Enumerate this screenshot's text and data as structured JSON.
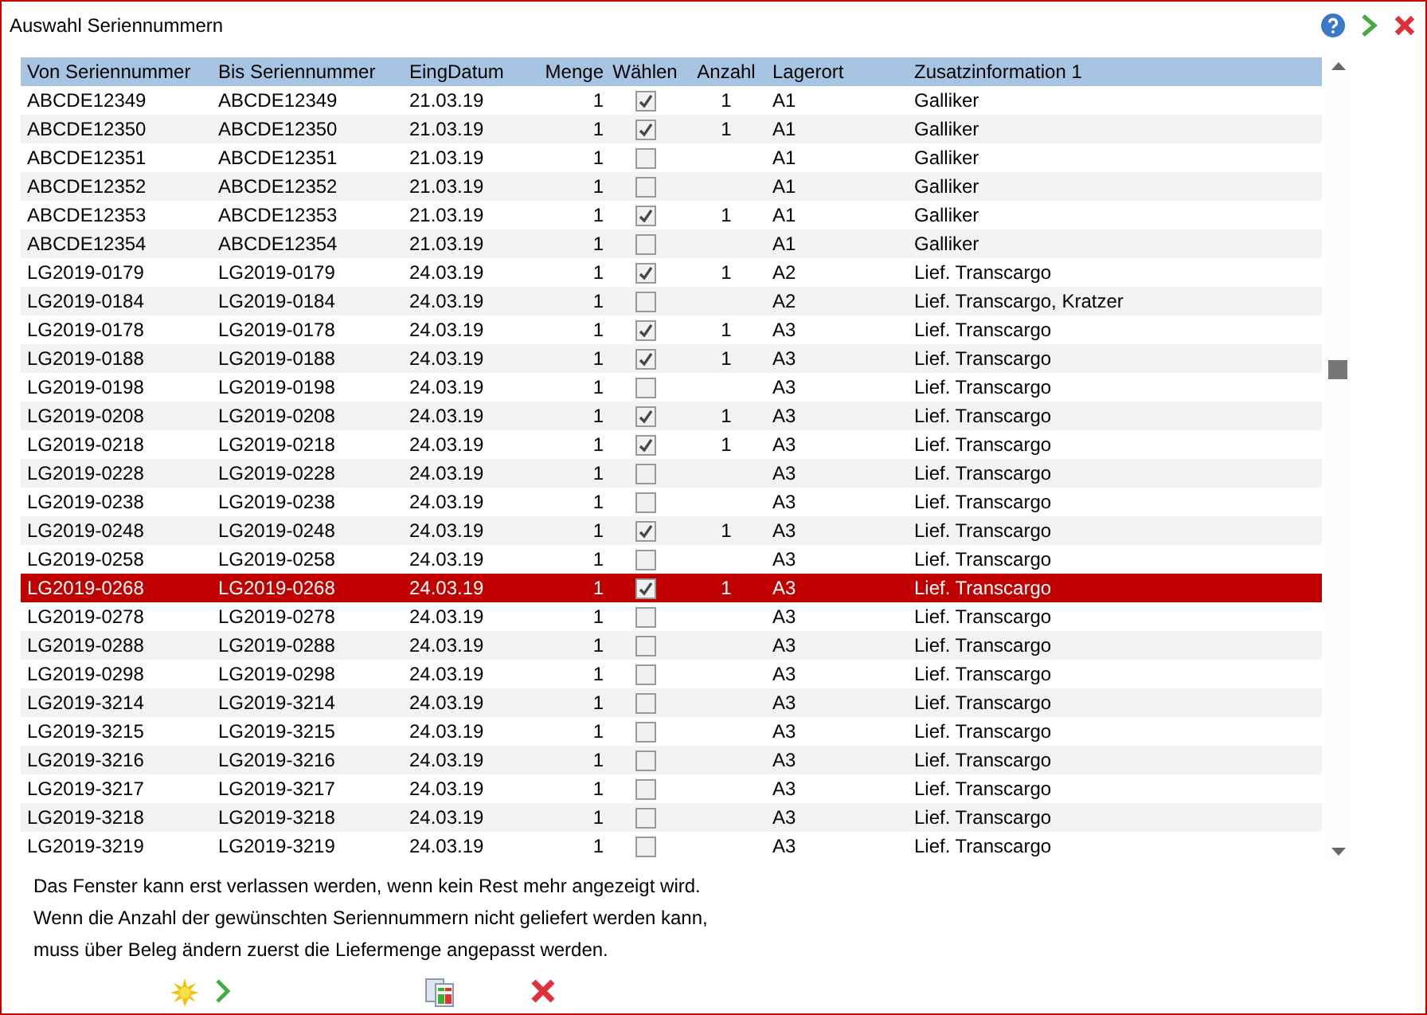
{
  "window": {
    "title": "Auswahl Seriennummern"
  },
  "table": {
    "columns": [
      "Von Seriennummer",
      "Bis Seriennummer",
      "EingDatum",
      "Menge",
      "Wählen",
      "Anzahl",
      "Lagerort",
      "Zusatzinformation 1"
    ],
    "rows": [
      {
        "von": "ABCDE12349",
        "bis": "ABCDE12349",
        "datum": "21.03.19",
        "menge": "1",
        "checked": true,
        "anzahl": "1",
        "lagerort": "A1",
        "zusatz": "Galliker",
        "selected": false
      },
      {
        "von": "ABCDE12350",
        "bis": "ABCDE12350",
        "datum": "21.03.19",
        "menge": "1",
        "checked": true,
        "anzahl": "1",
        "lagerort": "A1",
        "zusatz": "Galliker",
        "selected": false
      },
      {
        "von": "ABCDE12351",
        "bis": "ABCDE12351",
        "datum": "21.03.19",
        "menge": "1",
        "checked": false,
        "lagerort": "A1",
        "zusatz": "Galliker",
        "selected": false
      },
      {
        "von": "ABCDE12352",
        "bis": "ABCDE12352",
        "datum": "21.03.19",
        "menge": "1",
        "checked": false,
        "lagerort": "A1",
        "zusatz": "Galliker",
        "selected": false
      },
      {
        "von": "ABCDE12353",
        "bis": "ABCDE12353",
        "datum": "21.03.19",
        "menge": "1",
        "checked": true,
        "anzahl": "1",
        "lagerort": "A1",
        "zusatz": "Galliker",
        "selected": false
      },
      {
        "von": "ABCDE12354",
        "bis": "ABCDE12354",
        "datum": "21.03.19",
        "menge": "1",
        "checked": false,
        "lagerort": "A1",
        "zusatz": "Galliker",
        "selected": false
      },
      {
        "von": "LG2019-0179",
        "bis": "LG2019-0179",
        "datum": "24.03.19",
        "menge": "1",
        "checked": true,
        "anzahl": "1",
        "lagerort": "A2",
        "zusatz": "Lief. Transcargo",
        "selected": false
      },
      {
        "von": "LG2019-0184",
        "bis": "LG2019-0184",
        "datum": "24.03.19",
        "menge": "1",
        "checked": false,
        "lagerort": "A2",
        "zusatz": "Lief. Transcargo, Kratzer",
        "selected": false
      },
      {
        "von": "LG2019-0178",
        "bis": "LG2019-0178",
        "datum": "24.03.19",
        "menge": "1",
        "checked": true,
        "anzahl": "1",
        "lagerort": "A3",
        "zusatz": "Lief. Transcargo",
        "selected": false
      },
      {
        "von": "LG2019-0188",
        "bis": "LG2019-0188",
        "datum": "24.03.19",
        "menge": "1",
        "checked": true,
        "anzahl": "1",
        "lagerort": "A3",
        "zusatz": "Lief. Transcargo",
        "selected": false
      },
      {
        "von": "LG2019-0198",
        "bis": "LG2019-0198",
        "datum": "24.03.19",
        "menge": "1",
        "checked": false,
        "lagerort": "A3",
        "zusatz": "Lief. Transcargo",
        "selected": false
      },
      {
        "von": "LG2019-0208",
        "bis": "LG2019-0208",
        "datum": "24.03.19",
        "menge": "1",
        "checked": true,
        "anzahl": "1",
        "lagerort": "A3",
        "zusatz": "Lief. Transcargo",
        "selected": false
      },
      {
        "von": "LG2019-0218",
        "bis": "LG2019-0218",
        "datum": "24.03.19",
        "menge": "1",
        "checked": true,
        "anzahl": "1",
        "lagerort": "A3",
        "zusatz": "Lief. Transcargo",
        "selected": false
      },
      {
        "von": "LG2019-0228",
        "bis": "LG2019-0228",
        "datum": "24.03.19",
        "menge": "1",
        "checked": false,
        "lagerort": "A3",
        "zusatz": "Lief. Transcargo",
        "selected": false
      },
      {
        "von": "LG2019-0238",
        "bis": "LG2019-0238",
        "datum": "24.03.19",
        "menge": "1",
        "checked": false,
        "lagerort": "A3",
        "zusatz": "Lief. Transcargo",
        "selected": false
      },
      {
        "von": "LG2019-0248",
        "bis": "LG2019-0248",
        "datum": "24.03.19",
        "menge": "1",
        "checked": true,
        "anzahl": "1",
        "lagerort": "A3",
        "zusatz": "Lief. Transcargo",
        "selected": false
      },
      {
        "von": "LG2019-0258",
        "bis": "LG2019-0258",
        "datum": "24.03.19",
        "menge": "1",
        "checked": false,
        "lagerort": "A3",
        "zusatz": "Lief. Transcargo",
        "selected": false
      },
      {
        "von": "LG2019-0268",
        "bis": "LG2019-0268",
        "datum": "24.03.19",
        "menge": "1",
        "checked": true,
        "anzahl": "1",
        "lagerort": "A3",
        "zusatz": "Lief. Transcargo",
        "selected": true
      },
      {
        "von": "LG2019-0278",
        "bis": "LG2019-0278",
        "datum": "24.03.19",
        "menge": "1",
        "checked": false,
        "lagerort": "A3",
        "zusatz": "Lief. Transcargo",
        "selected": false
      },
      {
        "von": "LG2019-0288",
        "bis": "LG2019-0288",
        "datum": "24.03.19",
        "menge": "1",
        "checked": false,
        "lagerort": "A3",
        "zusatz": "Lief. Transcargo",
        "selected": false
      },
      {
        "von": "LG2019-0298",
        "bis": "LG2019-0298",
        "datum": "24.03.19",
        "menge": "1",
        "checked": false,
        "lagerort": "A3",
        "zusatz": "Lief. Transcargo",
        "selected": false
      },
      {
        "von": "LG2019-3214",
        "bis": "LG2019-3214",
        "datum": "24.03.19",
        "menge": "1",
        "checked": false,
        "lagerort": "A3",
        "zusatz": "Lief. Transcargo",
        "selected": false
      },
      {
        "von": "LG2019-3215",
        "bis": "LG2019-3215",
        "datum": "24.03.19",
        "menge": "1",
        "checked": false,
        "lagerort": "A3",
        "zusatz": "Lief. Transcargo",
        "selected": false
      },
      {
        "von": "LG2019-3216",
        "bis": "LG2019-3216",
        "datum": "24.03.19",
        "menge": "1",
        "checked": false,
        "lagerort": "A3",
        "zusatz": "Lief. Transcargo",
        "selected": false
      },
      {
        "von": "LG2019-3217",
        "bis": "LG2019-3217",
        "datum": "24.03.19",
        "menge": "1",
        "checked": false,
        "lagerort": "A3",
        "zusatz": "Lief. Transcargo",
        "selected": false
      },
      {
        "von": "LG2019-3218",
        "bis": "LG2019-3218",
        "datum": "24.03.19",
        "menge": "1",
        "checked": false,
        "lagerort": "A3",
        "zusatz": "Lief. Transcargo",
        "selected": false
      },
      {
        "von": "LG2019-3219",
        "bis": "LG2019-3219",
        "datum": "24.03.19",
        "menge": "1",
        "checked": false,
        "lagerort": "A3",
        "zusatz": "Lief. Transcargo",
        "selected": false
      }
    ]
  },
  "notes": [
    "Das Fenster kann erst verlassen werden, wenn kein Rest mehr angezeigt wird.",
    "Wenn die Anzahl der gewünschten Seriennummern nicht geliefert werden kann,",
    "muss über Beleg ändern zuerst die Liefermenge angepasst werden."
  ]
}
